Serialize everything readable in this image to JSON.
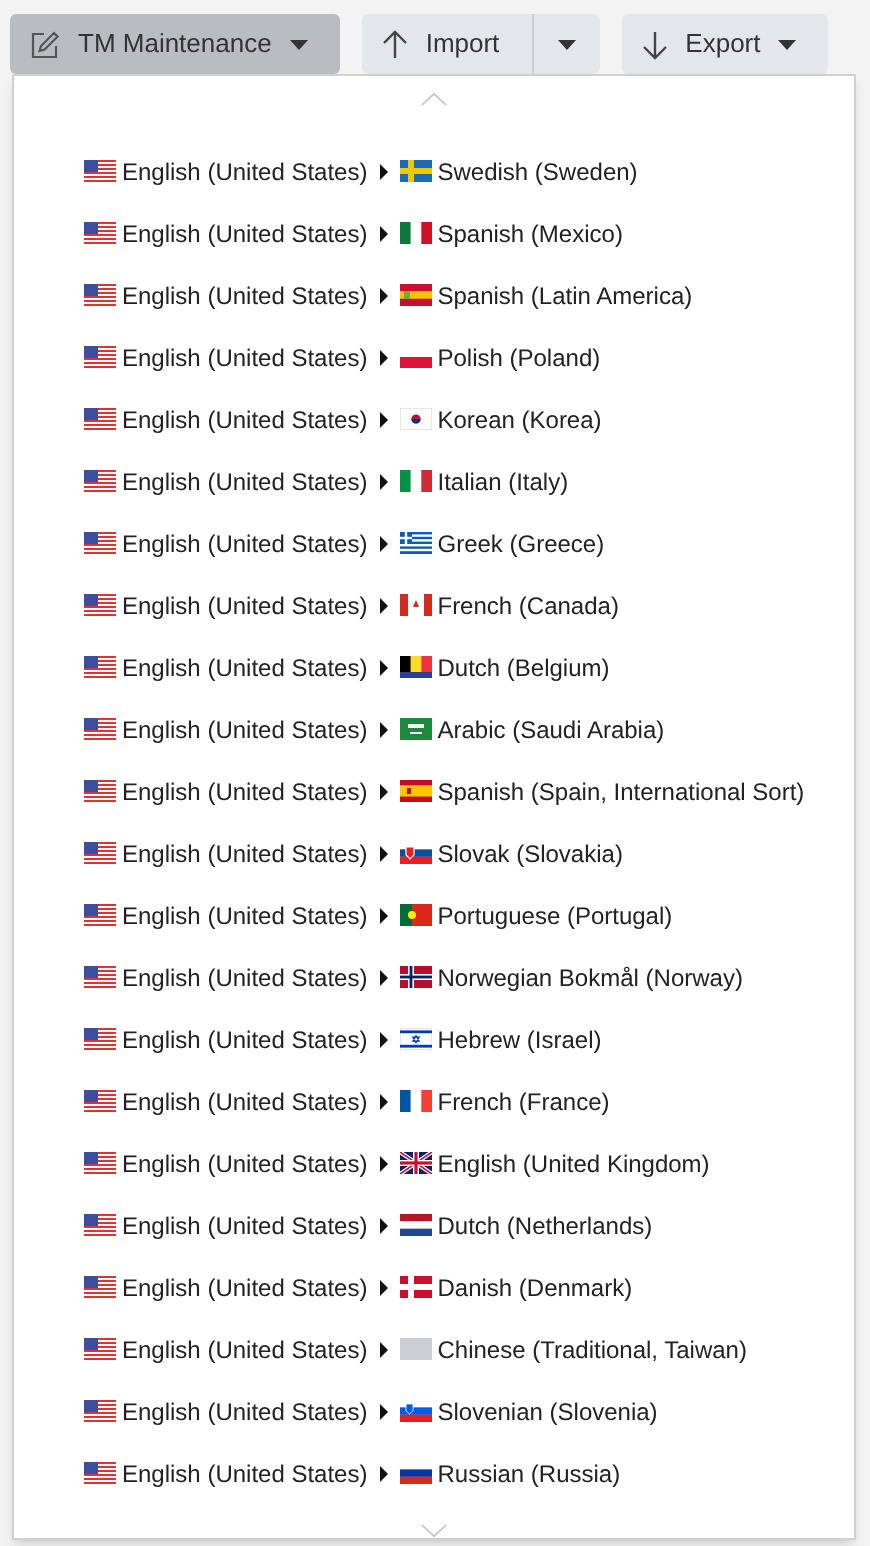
{
  "toolbar": [
    {
      "kind": "menu",
      "label": "TM Maintenance",
      "expanded": true
    },
    {
      "kind": "split",
      "label": "Import"
    },
    {
      "kind": "menu",
      "label": "Export",
      "expanded": false
    }
  ],
  "menu": {
    "items": [
      {
        "source": "English (United States)",
        "target": "Swedish (Sweden)"
      },
      {
        "source": "English (United States)",
        "target": "Spanish (Mexico)"
      },
      {
        "source": "English (United States)",
        "target": "Spanish (Latin America)"
      },
      {
        "source": "English (United States)",
        "target": "Polish (Poland)"
      },
      {
        "source": "English (United States)",
        "target": "Korean (Korea)"
      },
      {
        "source": "English (United States)",
        "target": "Italian (Italy)"
      },
      {
        "source": "English (United States)",
        "target": "Greek (Greece)"
      },
      {
        "source": "English (United States)",
        "target": "French (Canada)"
      },
      {
        "source": "English (United States)",
        "target": "Dutch (Belgium)"
      },
      {
        "source": "English (United States)",
        "target": "Arabic (Saudi Arabia)"
      },
      {
        "source": "English (United States)",
        "target": "Spanish (Spain, International Sort)"
      },
      {
        "source": "English (United States)",
        "target": "Slovak (Slovakia)"
      },
      {
        "source": "English (United States)",
        "target": "Portuguese (Portugal)"
      },
      {
        "source": "English (United States)",
        "target": "Norwegian Bokmål (Norway)"
      },
      {
        "source": "English (United States)",
        "target": "Hebrew (Israel)"
      },
      {
        "source": "English (United States)",
        "target": "French (France)"
      },
      {
        "source": "English (United States)",
        "target": "English (United Kingdom)"
      },
      {
        "source": "English (United States)",
        "target": "Dutch (Netherlands)"
      },
      {
        "source": "English (United States)",
        "target": "Danish (Denmark)"
      },
      {
        "source": "English (United States)",
        "target": "Chinese (Traditional, Taiwan)"
      },
      {
        "source": "English (United States)",
        "target": "Slovenian (Slovenia)"
      },
      {
        "source": "English (United States)",
        "target": "Russian (Russia)"
      }
    ]
  }
}
